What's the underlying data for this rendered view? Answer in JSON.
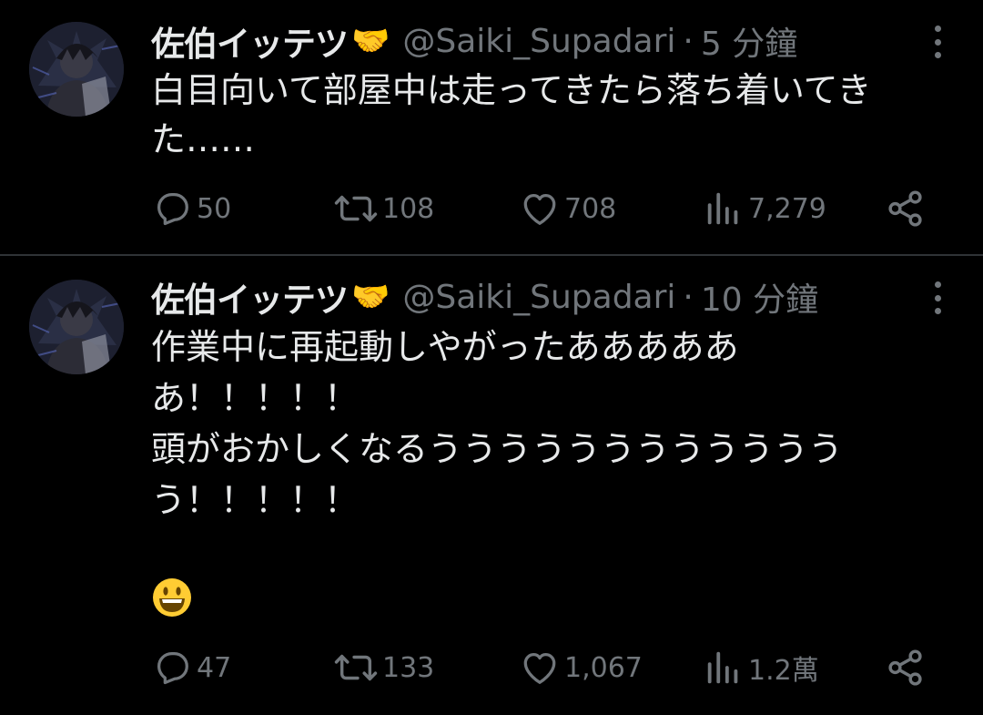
{
  "tweets": [
    {
      "display_name": "佐伯イッテツ",
      "name_emoji": "🤝",
      "handle": "@Saiki_Supadari",
      "separator": "·",
      "time": "5 分鐘",
      "text": "白目向いて部屋中は走ってきたら落ち着いてきた……",
      "emoji": "",
      "stats": {
        "replies": "50",
        "retweets": "108",
        "likes": "708",
        "views": "7,279"
      },
      "icons": [
        "more-icon",
        "reply-icon",
        "retweet-icon",
        "like-icon",
        "views-icon",
        "share-icon"
      ]
    },
    {
      "display_name": "佐伯イッテツ",
      "name_emoji": "🤝",
      "handle": "@Saiki_Supadari",
      "separator": "·",
      "time": "10 分鐘",
      "text": "作業中に再起動しやがったあああああ\nあ！！！！！\n頭がおかしくなるううううううううううううう！！！！！",
      "emoji": "😃",
      "stats": {
        "replies": "47",
        "retweets": "133",
        "likes": "1,067",
        "views": "1.2萬"
      },
      "icons": [
        "more-icon",
        "reply-icon",
        "retweet-icon",
        "like-icon",
        "views-icon",
        "share-icon"
      ]
    }
  ],
  "colors": {
    "background": "#000000",
    "text_primary": "#e7e9ea",
    "text_secondary": "#71767b",
    "divider": "#2f3336"
  }
}
